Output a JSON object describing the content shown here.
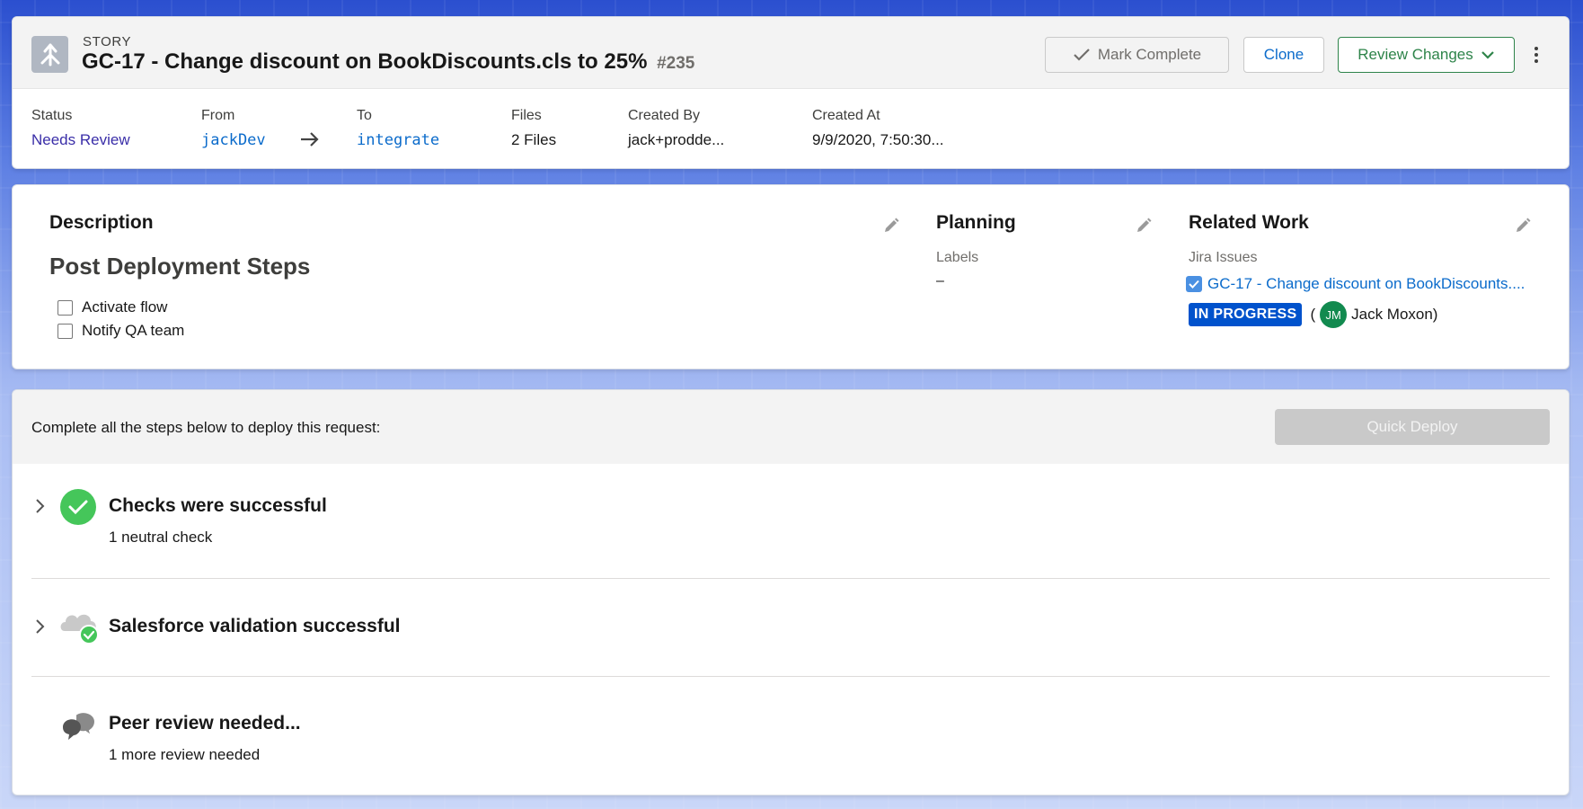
{
  "header": {
    "kicker": "STORY",
    "title": "GC-17 - Change discount on BookDiscounts.cls to 25%",
    "number": "#235",
    "buttons": {
      "mark_complete": "Mark Complete",
      "clone": "Clone",
      "review_changes": "Review Changes"
    },
    "meta": {
      "status_label": "Status",
      "status_value": "Needs Review",
      "from_label": "From",
      "from_value": "jackDev",
      "to_label": "To",
      "to_value": "integrate",
      "files_label": "Files",
      "files_value": "2 Files",
      "created_by_label": "Created By",
      "created_by_value": "jack+prodde...",
      "created_at_label": "Created At",
      "created_at_value": "9/9/2020, 7:50:30..."
    }
  },
  "description": {
    "title": "Description",
    "heading": "Post Deployment Steps",
    "todos": [
      "Activate flow",
      "Notify QA team"
    ]
  },
  "planning": {
    "title": "Planning",
    "labels_label": "Labels",
    "labels_value": "–"
  },
  "related": {
    "title": "Related Work",
    "jira_label": "Jira Issues",
    "issue_text": "GC-17 - Change discount on BookDiscounts....",
    "status_badge": "IN PROGRESS",
    "open_paren": "(",
    "avatar_initials": "JM",
    "assignee": "Jack Moxon)"
  },
  "deploy": {
    "instruction": "Complete all the steps below to deploy this request:",
    "quick_deploy": "Quick Deploy",
    "steps": [
      {
        "title": "Checks were successful",
        "subtitle": "1 neutral check"
      },
      {
        "title": "Salesforce validation successful",
        "subtitle": ""
      },
      {
        "title": "Peer review needed...",
        "subtitle": "1 more review needed"
      }
    ]
  },
  "colors": {
    "link_blue": "#0b6bcb",
    "status_purple": "#3a2ea8",
    "success_green": "#45c65a",
    "review_green": "#2e844a",
    "jira_blue": "#0052cc"
  },
  "icons": [
    "story-icon",
    "check-icon",
    "chevron-down-icon",
    "more-vertical-icon",
    "arrow-right-icon",
    "pencil-icon",
    "checkbox-icon",
    "chevron-right-icon",
    "success-check-icon",
    "salesforce-cloud-icon",
    "chat-bubbles-icon"
  ]
}
